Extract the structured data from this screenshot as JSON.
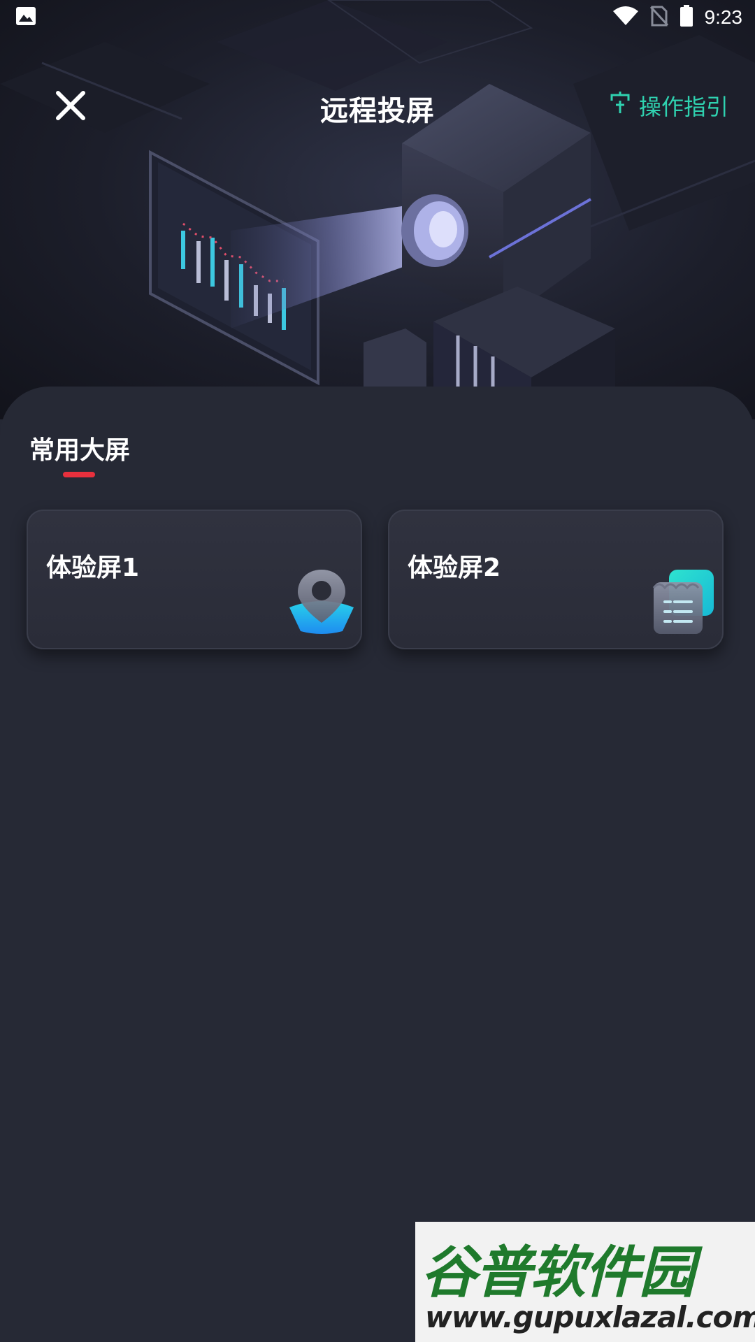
{
  "status_bar": {
    "time": "9:23",
    "left_icon": "image-notification-icon",
    "right_icons": [
      "wifi-icon",
      "no-sim-icon",
      "battery-icon"
    ]
  },
  "header": {
    "close_icon": "close-icon",
    "title": "远程投屏",
    "guide_icon": "guide-pin-icon",
    "guide_label": "操作指引"
  },
  "section": {
    "title": "常用大屏"
  },
  "cards": [
    {
      "label": "体验屏1",
      "icon": "location-pin-icon"
    },
    {
      "label": "体验屏2",
      "icon": "document-icon"
    }
  ],
  "watermark": {
    "brand": "谷普软件园",
    "url": "www.gupuxlazal.com"
  },
  "colors": {
    "background": "#252834",
    "accent_green": "#2fd2b0",
    "accent_red": "#e8303d"
  }
}
